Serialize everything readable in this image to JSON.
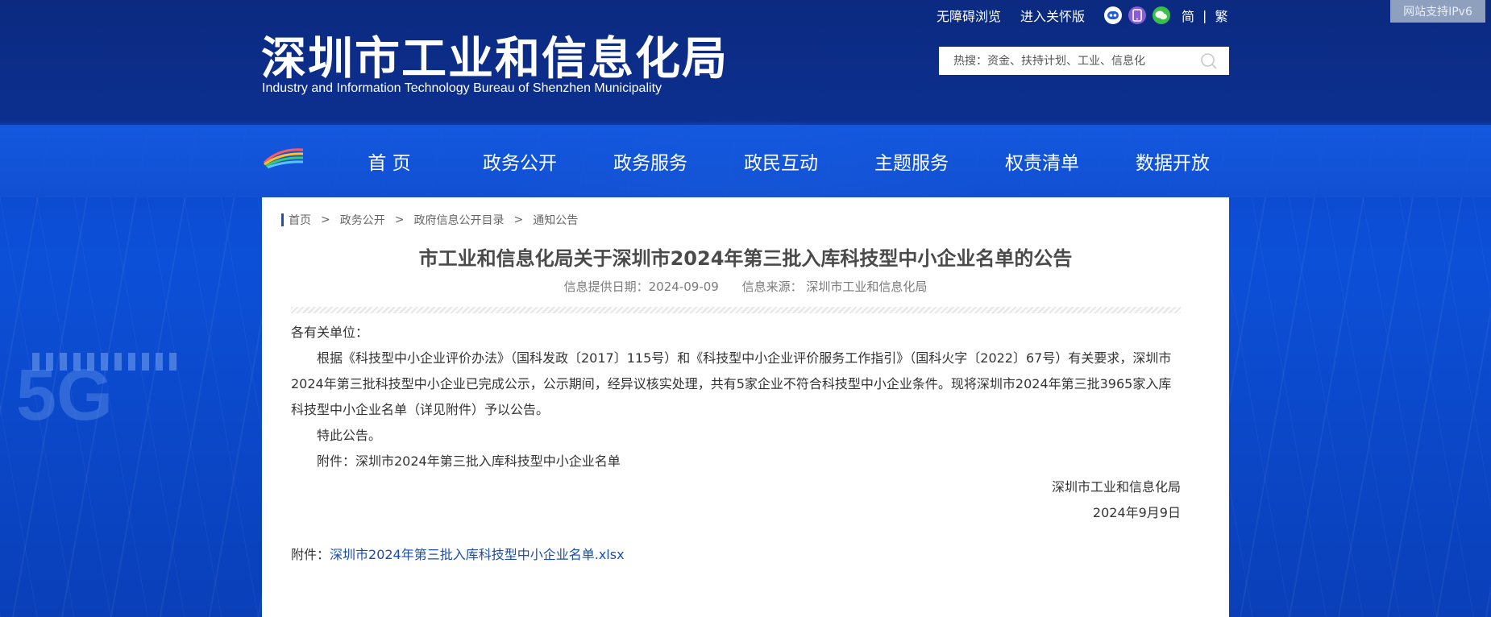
{
  "header": {
    "site_title": "深圳市工业和信息化局",
    "site_subtitle": "Industry and Information Technology Bureau of Shenzhen Municipality",
    "accessibility_link": "无障碍浏览",
    "elderly_link": "进入关怀版",
    "lang_simplified": "简",
    "lang_separator": "|",
    "lang_traditional": "繁",
    "ipv6_badge": "网站支持IPv6",
    "search_placeholder": "热搜：资金、扶持计划、工业、信息化"
  },
  "nav": {
    "items": [
      "首 页",
      "政务公开",
      "政务服务",
      "政民互动",
      "主题服务",
      "权责清单",
      "数据开放"
    ]
  },
  "breadcrumb": [
    "首页",
    "政务公开",
    "政府信息公开目录",
    "通知公告"
  ],
  "breadcrumb_separator": ">",
  "article": {
    "title": "市工业和信息化局关于深圳市2024年第三批入库科技型中小企业名单的公告",
    "date_label": "信息提供日期：2024-09-09",
    "source_label": "信息来源：   深圳市工业和信息化局",
    "salutation": "各有关单位：",
    "paragraph1": "根据《科技型中小企业评价办法》（国科发政〔2017〕115号）和《科技型中小企业评价服务工作指引》（国科火字〔2022〕67号）有关要求，深圳市2024年第三批科技型中小企业已完成公示，公示期间，经异议核实处理，共有5家企业不符合科技型中小企业条件。现将深圳市2024年第三批3965家入库科技型中小企业名单（详见附件）予以公告。",
    "paragraph2": "特此公告。",
    "paragraph3": "附件：深圳市2024年第三批入库科技型中小企业名单",
    "signature": "深圳市工业和信息化局",
    "sign_date": "2024年9月9日",
    "attachment_label": "附件：",
    "attachment_link": "深圳市2024年第三批入库科技型中小企业名单.xlsx"
  },
  "decor": {
    "bg_text": "5G"
  },
  "colors": {
    "header_bg": "#0b2a80",
    "nav_bg": "#1450d9",
    "link": "#1c4ea8",
    "breadcrumb_bar": "#1f4fb7"
  }
}
